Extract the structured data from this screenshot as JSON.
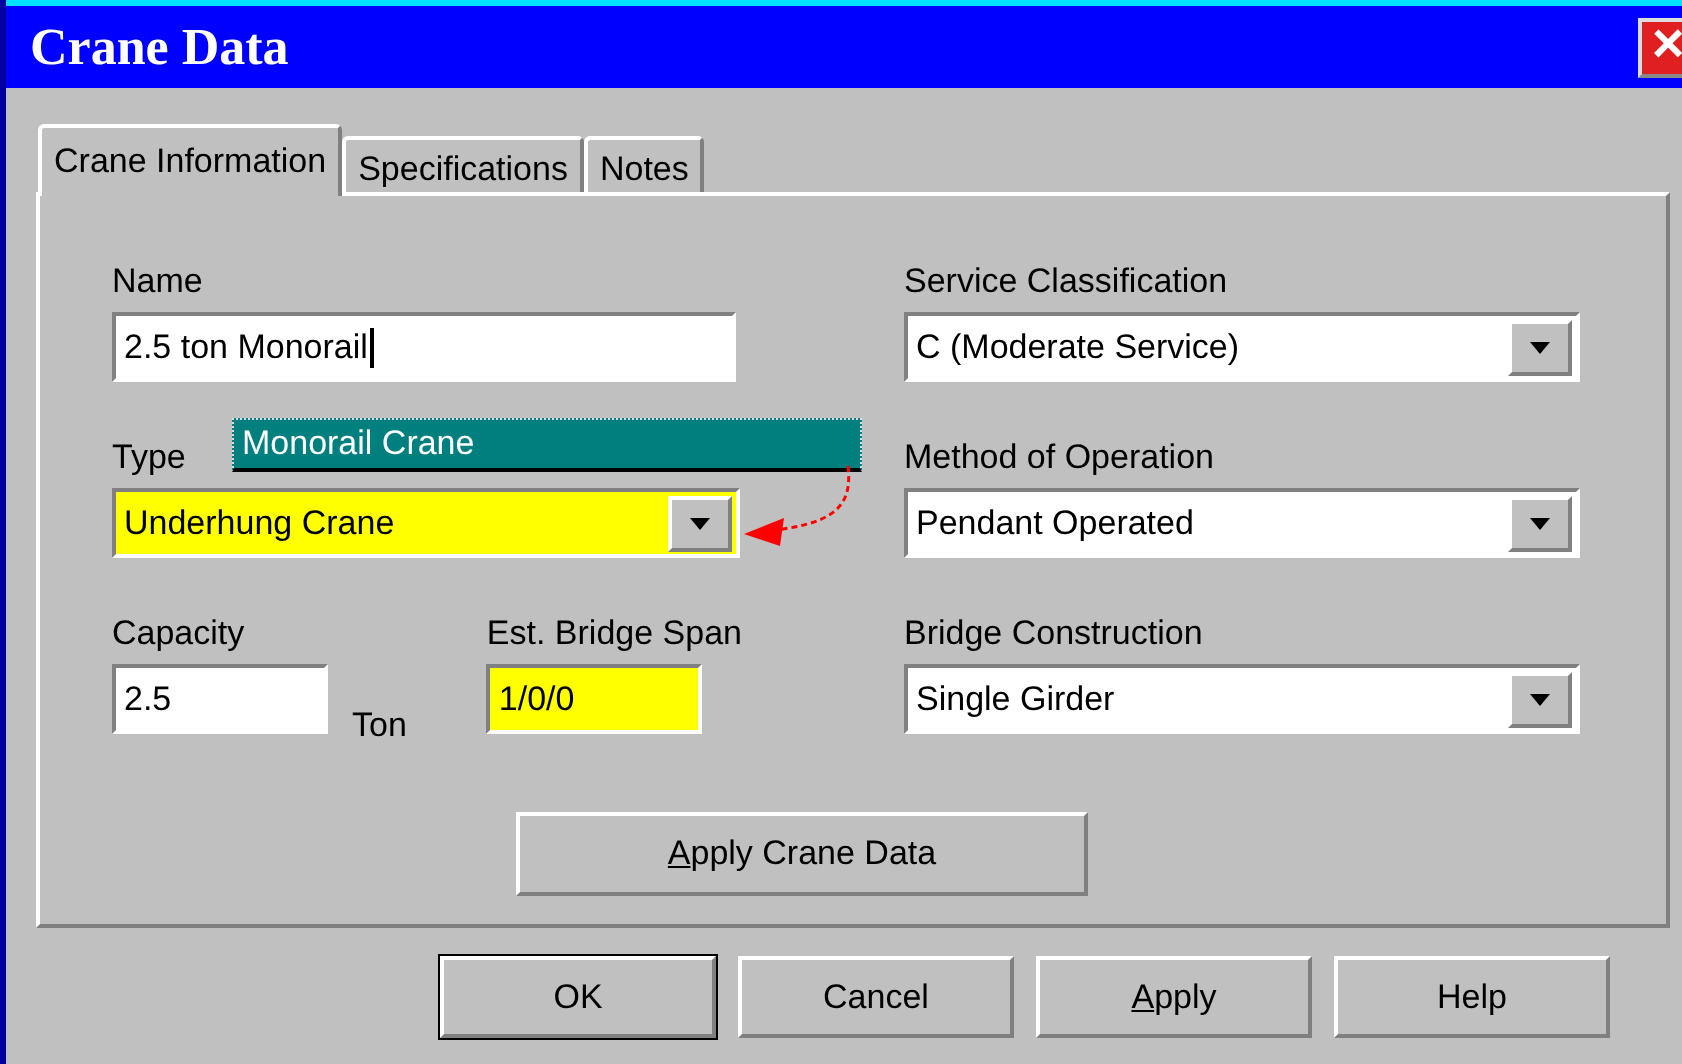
{
  "window": {
    "title": "Crane Data",
    "close": "×"
  },
  "tabs": [
    {
      "label": "Crane Information",
      "selected": true
    },
    {
      "label": "Specifications",
      "selected": false
    },
    {
      "label": "Notes",
      "selected": false
    }
  ],
  "fields": {
    "name": {
      "label": "Name",
      "value": "2.5 ton Monorail",
      "focused": true,
      "highlighted": false
    },
    "service_classification": {
      "label": "Service Classification",
      "value": "C (Moderate Service)",
      "highlighted": false
    },
    "type": {
      "label": "Type",
      "value": "Underhung Crane",
      "highlighted": true
    },
    "method_of_operation": {
      "label": "Method of Operation",
      "value": "Pendant Operated",
      "highlighted": false
    },
    "capacity": {
      "label": "Capacity",
      "value": "2.5",
      "unit": "Ton",
      "highlighted": false
    },
    "est_bridge_span": {
      "label": "Est. Bridge Span",
      "value": "1/0/0",
      "highlighted": true
    },
    "bridge_construction": {
      "label": "Bridge Construction",
      "value": "Single Girder",
      "highlighted": false
    }
  },
  "tooltip": {
    "text": "Monorail Crane"
  },
  "apply_crane_data": {
    "label": "Apply Crane Data",
    "mnemonic": true
  },
  "buttons": [
    {
      "label": "OK",
      "default": true,
      "mnemonic": false
    },
    {
      "label": "Cancel",
      "default": false,
      "mnemonic": false
    },
    {
      "label": "Apply",
      "default": false,
      "mnemonic": true
    },
    {
      "label": "Help",
      "default": false,
      "mnemonic": false
    }
  ]
}
